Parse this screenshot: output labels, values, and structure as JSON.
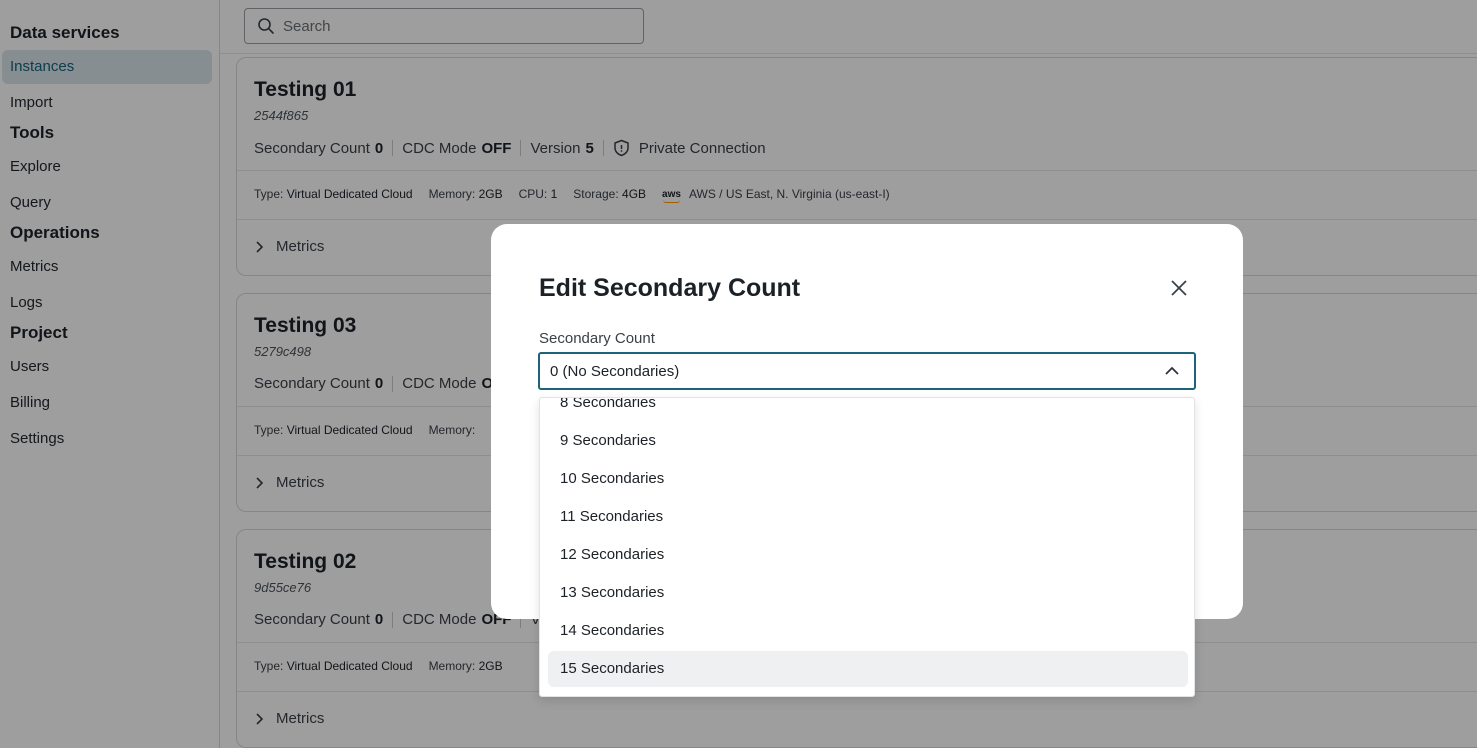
{
  "sidebar": {
    "sections": [
      {
        "title": "Data services",
        "items": [
          {
            "label": "Instances",
            "active": true
          },
          {
            "label": "Import"
          }
        ]
      },
      {
        "title": "Tools",
        "items": [
          {
            "label": "Explore"
          },
          {
            "label": "Query"
          }
        ]
      },
      {
        "title": "Operations",
        "items": [
          {
            "label": "Metrics"
          },
          {
            "label": "Logs"
          }
        ]
      },
      {
        "title": "Project",
        "items": [
          {
            "label": "Users"
          },
          {
            "label": "Billing"
          },
          {
            "label": "Settings"
          }
        ]
      }
    ]
  },
  "search": {
    "placeholder": "Search"
  },
  "cards": [
    {
      "title": "Testing 01",
      "id": "2544f865",
      "secondary_label": "Secondary Count",
      "secondary_value": "0",
      "cdc_label": "CDC Mode",
      "cdc_value": "OFF",
      "version_label": "Version",
      "version_value": "5",
      "private_label": "Private Connection",
      "type_label": "Type:",
      "type_value": "Virtual Dedicated Cloud",
      "memory_label": "Memory:",
      "memory_value": "2GB",
      "cpu_label": "CPU:",
      "cpu_value": "1",
      "storage_label": "Storage:",
      "storage_value": "4GB",
      "provider_logo": "aws",
      "region": "AWS / US East, N. Virginia (us-east-I)",
      "metrics_label": "Metrics"
    },
    {
      "title": "Testing 03",
      "id": "5279c498",
      "secondary_label": "Secondary Count",
      "secondary_value": "0",
      "cdc_label": "CDC Mode",
      "cdc_value": "OF",
      "type_label": "Type:",
      "type_value": "Virtual Dedicated Cloud",
      "memory_label": "Memory:",
      "metrics_label": "Metrics"
    },
    {
      "title": "Testing 02",
      "id": "9d55ce76",
      "secondary_label": "Secondary Count",
      "secondary_value": "0",
      "cdc_label": "CDC Mode",
      "cdc_value": "OFF",
      "version_fragment": "Ve",
      "type_label": "Type:",
      "type_value": "Virtual Dedicated Cloud",
      "memory_label": "Memory:",
      "memory_value": "2GB",
      "metrics_label": "Metrics"
    }
  ],
  "modal": {
    "title": "Edit Secondary Count",
    "field_label": "Secondary Count",
    "selected_value": "0 (No Secondaries)",
    "options": [
      "8 Secondaries",
      "9 Secondaries",
      "10 Secondaries",
      "11 Secondaries",
      "12 Secondaries",
      "13 Secondaries",
      "14 Secondaries",
      "15 Secondaries"
    ],
    "hovered_option": "15 Secondaries"
  },
  "colors": {
    "accent": "#1d6478",
    "active_bg": "#d9e6ec",
    "overlay": "rgba(0,0,0,0.38)"
  }
}
